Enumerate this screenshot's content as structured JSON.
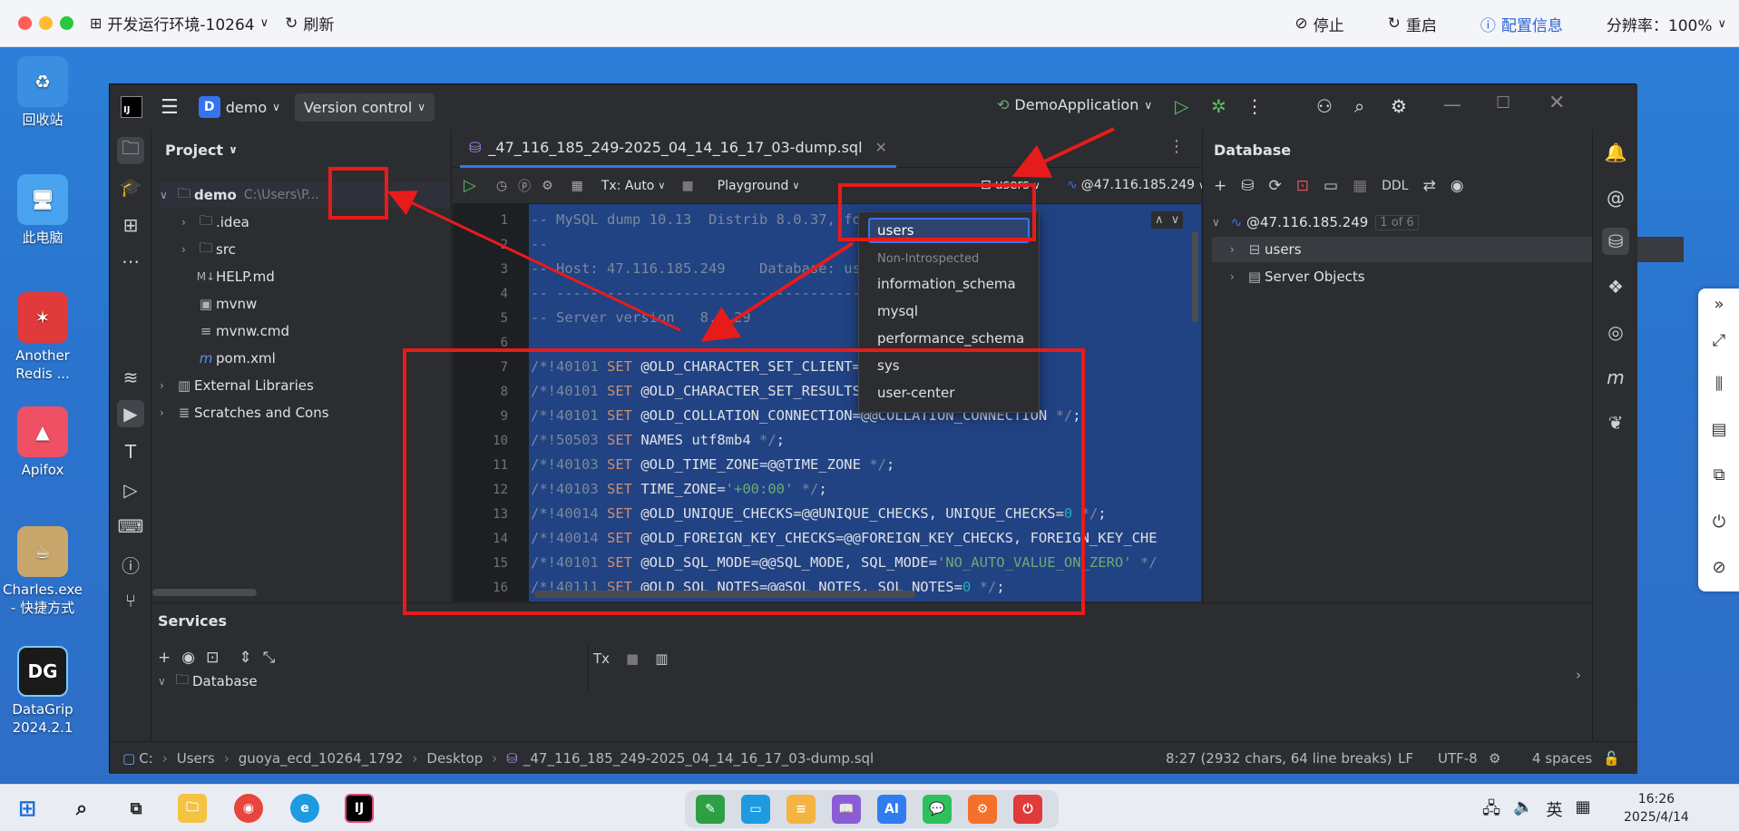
{
  "host": {
    "env_title": "开发运行环境-10264",
    "refresh": "刷新",
    "stop": "停止",
    "restart": "重启",
    "config": "配置信息",
    "resolution": "分辨率：100%"
  },
  "desktop_icons": [
    {
      "label": "回收站",
      "color": "#3a8fe0"
    },
    {
      "label": "此电脑",
      "color": "#4aa3ee"
    },
    {
      "label": "Another Redis ...",
      "color": "#e03a3a"
    },
    {
      "label": "Apifox",
      "color": "#f05064"
    },
    {
      "label": "Charles.exe - 快捷方式",
      "color": "#c9a66b"
    },
    {
      "label": "DataGrip 2024.2.1",
      "color": "#1a1a1a"
    }
  ],
  "ide": {
    "project_name": "demo",
    "project_letter": "D",
    "version_control": "Version control",
    "run_config": "DemoApplication",
    "project_header": "Project",
    "tree": [
      {
        "label": "demo",
        "extra": "C:\\Users\\P...",
        "level": 0,
        "icon": "folder"
      },
      {
        "label": ".idea",
        "level": 1,
        "icon": "folder"
      },
      {
        "label": "src",
        "level": 1,
        "icon": "folder"
      },
      {
        "label": "HELP.md",
        "level": 1,
        "icon": "md"
      },
      {
        "label": "mvnw",
        "level": 1,
        "icon": "file"
      },
      {
        "label": "mvnw.cmd",
        "level": 1,
        "icon": "file"
      },
      {
        "label": "pom.xml",
        "level": 1,
        "icon": "maven"
      },
      {
        "label": "External Libraries",
        "level": 0,
        "icon": "lib"
      },
      {
        "label": "Scratches and Cons",
        "level": 0,
        "icon": "scratch"
      }
    ],
    "tab_file": "_47_116_185_249-2025_04_14_16_17_03-dump.sql",
    "toolbar": {
      "tx": "Tx: Auto",
      "playground": "Playground",
      "schema": "users",
      "datasource": "@47.116.185.249"
    },
    "line_numbers": [
      "1",
      "2",
      "3",
      "4",
      "5",
      "6",
      "7",
      "8",
      "9",
      "10",
      "11",
      "12",
      "13",
      "14",
      "15",
      "16"
    ],
    "code_lines": [
      "-- MySQL dump 10.13  Distrib 8.0.37, for Win64 (",
      "--",
      "-- Host: 47.116.185.249    Database: users",
      "-- ------------------------------------------------------",
      "-- Server version   8.0.29",
      "",
      "/*!40101 SET @OLD_CHARACTER_SET_CLIENT=@@CHARACT",
      "/*!40101 SET @OLD_CHARACTER_SET_RESULTS=@@CHARAC",
      "/*!40101 SET @OLD_COLLATION_CONNECTION=@@COLLATION_CONNECTION */;",
      "/*!50503 SET NAMES utf8mb4 */;",
      "/*!40103 SET @OLD_TIME_ZONE=@@TIME_ZONE */;",
      "/*!40103 SET TIME_ZONE='+00:00' */;",
      "/*!40014 SET @OLD_UNIQUE_CHECKS=@@UNIQUE_CHECKS, UNIQUE_CHECKS=0 */;",
      "/*!40014 SET @OLD_FOREIGN_KEY_CHECKS=@@FOREIGN_KEY_CHECKS, FOREIGN_KEY_CHE",
      "/*!40101 SET @OLD_SQL_MODE=@@SQL_MODE, SQL_MODE='NO_AUTO_VALUE_ON_ZERO' */",
      "/*!40111 SET @OLD_SQL_NOTES=@@SQL_NOTES, SQL_NOTES=0 */;"
    ],
    "dropdown": {
      "selected": "users",
      "section": "Non-Introspected",
      "items": [
        "information_schema",
        "mysql",
        "performance_schema",
        "sys",
        "user-center"
      ]
    },
    "database": {
      "header": "Database",
      "ddl": "DDL",
      "host": "@47.116.185.249",
      "count": "1 of 6",
      "schema": "users",
      "server_objects": "Server Objects"
    },
    "services": {
      "header": "Services",
      "tx": "Tx",
      "db_node": "Database"
    },
    "status": {
      "path": [
        "C:",
        "Users",
        "guoya_ecd_10264_1792",
        "Desktop",
        "_47_116_185_249-2025_04_14_16_17_03-dump.sql"
      ],
      "position": "8:27 (2932 chars, 64 line breaks)",
      "line_sep": "LF",
      "encoding": "UTF-8",
      "indent": "4 spaces"
    }
  },
  "taskbar": {
    "ime": "英",
    "time": "16:26",
    "date": "2025/4/14",
    "dock_ai": "AI"
  }
}
